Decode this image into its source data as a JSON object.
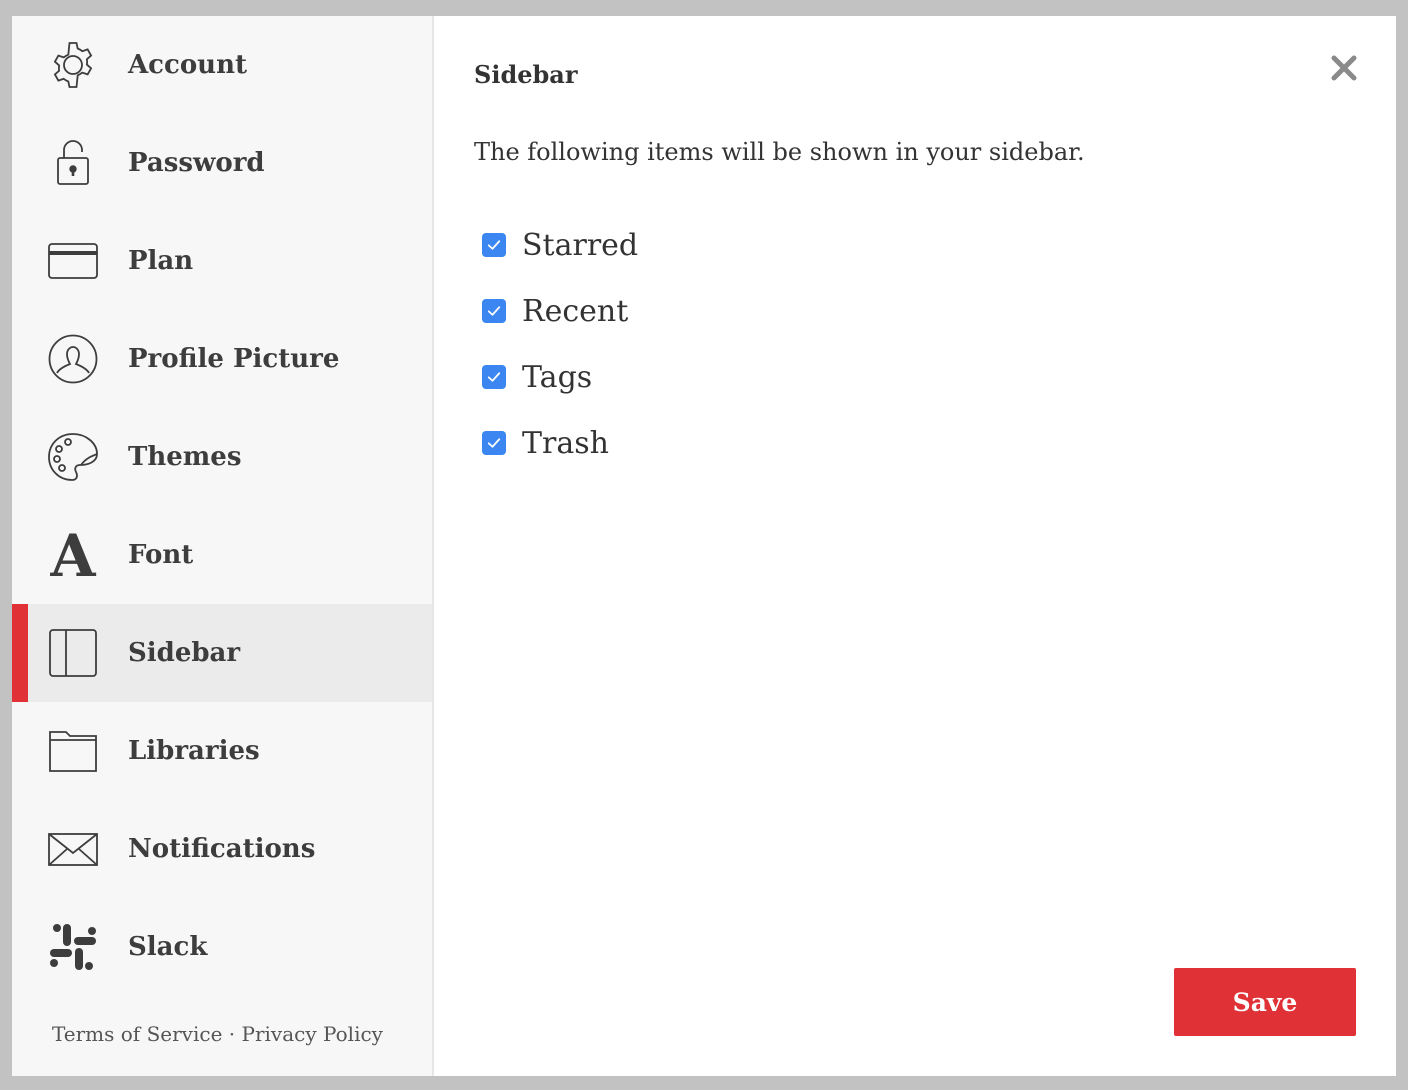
{
  "nav": {
    "items": [
      {
        "label": "Account",
        "icon": "gear-icon"
      },
      {
        "label": "Password",
        "icon": "lock-icon"
      },
      {
        "label": "Plan",
        "icon": "credit-card-icon"
      },
      {
        "label": "Profile Picture",
        "icon": "user-avatar-icon"
      },
      {
        "label": "Themes",
        "icon": "palette-icon"
      },
      {
        "label": "Font",
        "icon": "font-icon"
      },
      {
        "label": "Sidebar",
        "icon": "sidebar-icon",
        "active": true
      },
      {
        "label": "Libraries",
        "icon": "folder-icon"
      },
      {
        "label": "Notifications",
        "icon": "envelope-icon"
      },
      {
        "label": "Slack",
        "icon": "slack-icon"
      }
    ],
    "footer": {
      "terms": "Terms of Service",
      "separator": " · ",
      "privacy": "Privacy Policy"
    }
  },
  "main": {
    "title": "Sidebar",
    "description": "The following items will be shown in your sidebar.",
    "options": [
      {
        "label": "Starred",
        "checked": true
      },
      {
        "label": "Recent",
        "checked": true
      },
      {
        "label": "Tags",
        "checked": true
      },
      {
        "label": "Trash",
        "checked": true
      }
    ],
    "save_label": "Save",
    "close_icon": "close-icon"
  },
  "colors": {
    "accent": "#e03137",
    "checkbox": "#3b86f0",
    "nav_background": "#f7f7f7",
    "nav_active_background": "#ebebeb"
  }
}
